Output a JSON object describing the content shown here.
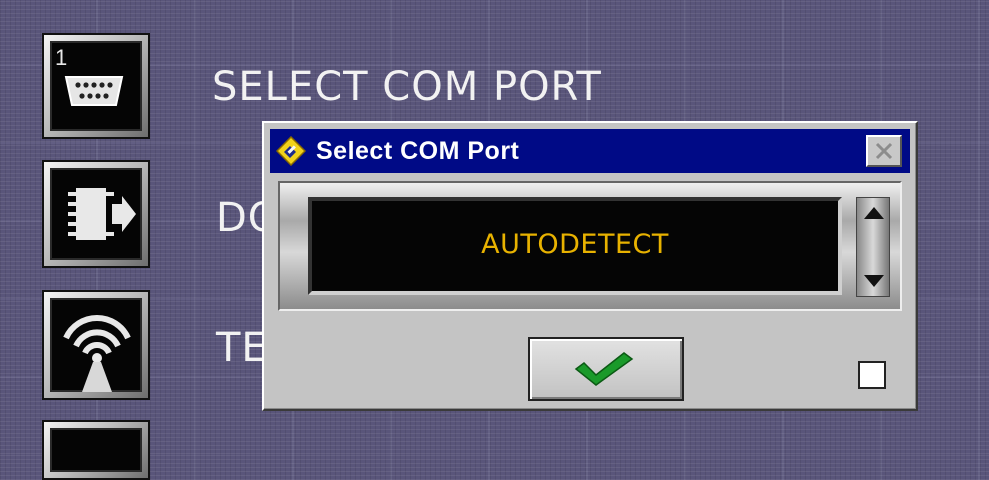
{
  "side_menu": {
    "buttons": [
      {
        "number": "1",
        "icon": "serial-port-icon"
      },
      {
        "icon": "chip-export-icon"
      },
      {
        "icon": "antenna-signal-icon"
      },
      {
        "icon": "unknown-icon"
      }
    ],
    "items": [
      {
        "label": "SELECT COM PORT"
      },
      {
        "label": "DO"
      },
      {
        "label": "TE"
      }
    ]
  },
  "dialog": {
    "title": "Select COM Port",
    "title_icon": "diamond-tool-icon",
    "close_icon": "close-icon",
    "list": {
      "value": "AUTODETECT",
      "scroll_up_icon": "arrow-up-icon",
      "scroll_down_icon": "arrow-down-icon"
    },
    "ok_icon": "checkmark-icon",
    "checkbox_checked": false
  },
  "colors": {
    "background": "#59557a",
    "titlebar": "#000a86",
    "list_text": "#e8b200",
    "check_green": "#1a9a2a"
  }
}
